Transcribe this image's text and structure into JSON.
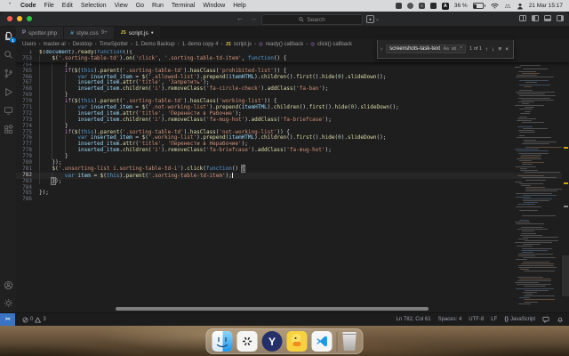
{
  "menu_bar": {
    "items": [
      "Code",
      "File",
      "Edit",
      "Selection",
      "View",
      "Go",
      "Run",
      "Terminal",
      "Window",
      "Help"
    ],
    "battery": "36 %",
    "input_source": "A",
    "clock": "21 Mar 15:17"
  },
  "title_bar": {
    "search_placeholder": "Search"
  },
  "tabs": [
    {
      "label": "spotter.php",
      "icon": "php",
      "active": false
    },
    {
      "label": "style.css",
      "icon": "css",
      "badge": "9+",
      "active": false
    },
    {
      "label": "script.js",
      "icon": "js",
      "dirty": true,
      "active": true
    }
  ],
  "breadcrumbs": {
    "separator": "›",
    "items": [
      {
        "label": "Users"
      },
      {
        "label": "master-al"
      },
      {
        "label": "Desktop"
      },
      {
        "label": "TimeSpotter"
      },
      {
        "label": "1. Demo Backup"
      },
      {
        "label": "1. demo copy 4"
      },
      {
        "label": "script.js",
        "icon": "js"
      },
      {
        "label": "ready() callback",
        "icon": "symbol"
      },
      {
        "label": "click() callback",
        "icon": "symbol"
      }
    ]
  },
  "find_widget": {
    "query": "screenshots-task-text",
    "toggles": [
      "Aa",
      "ab",
      ".*"
    ],
    "matches": "1 of 1"
  },
  "editor": {
    "sticky": [
      {
        "num": 1,
        "text": "$(document).ready(function(){"
      },
      {
        "num": 753,
        "text": "    $('.sorting-table-td').on('click', '.sorting-table-td-item', function() {"
      }
    ],
    "lines": [
      {
        "num": 764,
        "text": "        }"
      },
      {
        "num": 765,
        "text": "        if($(this).parent('.sorting-table-td').hasClass('prohibited-list')) {"
      },
      {
        "num": 766,
        "text": "            var inserted_item = $('.allowed-list').prepend(itemHTML).children().first().hide(0).slideDown();"
      },
      {
        "num": 767,
        "text": "            inserted_item.attr('title', 'Запретить');"
      },
      {
        "num": 768,
        "text": "            inserted_item.children('i').removeClass('fa-circle-check').addClass('fa-ban');"
      },
      {
        "num": 769,
        "text": "        }"
      },
      {
        "num": 770,
        "text": "        if($(this).parent('.sorting-table-td').hasClass('working-list')) {"
      },
      {
        "num": 771,
        "text": "            var inserted_item = $('.not-working-list').prepend(itemHTML).children().first().hide(0).slideDown();"
      },
      {
        "num": 772,
        "text": "            inserted_item.attr('title', 'Перенести в Рабочие');"
      },
      {
        "num": 773,
        "text": "            inserted_item.children('i').removeClass('fa-mug-hot').addClass('fa-briefcase');"
      },
      {
        "num": 774,
        "text": "        }"
      },
      {
        "num": 775,
        "text": "        if($(this).parent('.sorting-table-td').hasClass('not-working-list')) {"
      },
      {
        "num": 776,
        "text": "            var inserted_item = $('.working-list').prepend(itemHTML).children().first().hide(0).slideDown();"
      },
      {
        "num": 777,
        "text": "            inserted_item.attr('title', 'Перенести в Нерабочие');"
      },
      {
        "num": 778,
        "text": "            inserted_item.children('i').removeClass('fa-briefcase').addClass('fa-mug-hot');"
      },
      {
        "num": 779,
        "text": "        }"
      },
      {
        "num": 780,
        "text": "    });"
      },
      {
        "num": 781,
        "text": "    $('.unsorting-list i.sorting-table-td-i').click(function() {"
      },
      {
        "num": 782,
        "text": "        var item = $(this).parent('.sorting-table-td-item');"
      },
      {
        "num": 783,
        "text": "    });"
      },
      {
        "num": 784,
        "text": ""
      },
      {
        "num": 785,
        "text": "});"
      },
      {
        "num": 786,
        "text": ""
      }
    ],
    "cursor_line": 782,
    "bracket_highlights": [
      {
        "line": 781,
        "char": "{",
        "which": "last"
      },
      {
        "line": 783,
        "char": "}",
        "which": "first"
      }
    ]
  },
  "status_bar": {
    "errors": "0",
    "warnings": "3",
    "remote_glyph": "><",
    "line_col": "Ln 782, Col 61",
    "spaces": "Spaces: 4",
    "encoding": "UTF-8",
    "eol": "LF",
    "braces": "{}",
    "language": "JavaScript"
  },
  "icons": {
    "back": "←",
    "forward": "→",
    "chevron_down": "⌄",
    "find_prev": "↑",
    "find_next": "↓",
    "find_in_selection": "≡",
    "close": "×",
    "dirty_dot": "●",
    "grip": "›",
    "php_glyph": "P",
    "css_glyph": "#",
    "js_glyph": "JS",
    "symbol_glyph": "◎"
  },
  "dock": {
    "apps": [
      "finder",
      "chatgpt",
      "y-browser",
      "duck",
      "vscode",
      "trash"
    ]
  },
  "colors": {
    "badge": "#0078d4",
    "remote": "#3b73c4",
    "editor_bg": "#1e1e1e"
  }
}
